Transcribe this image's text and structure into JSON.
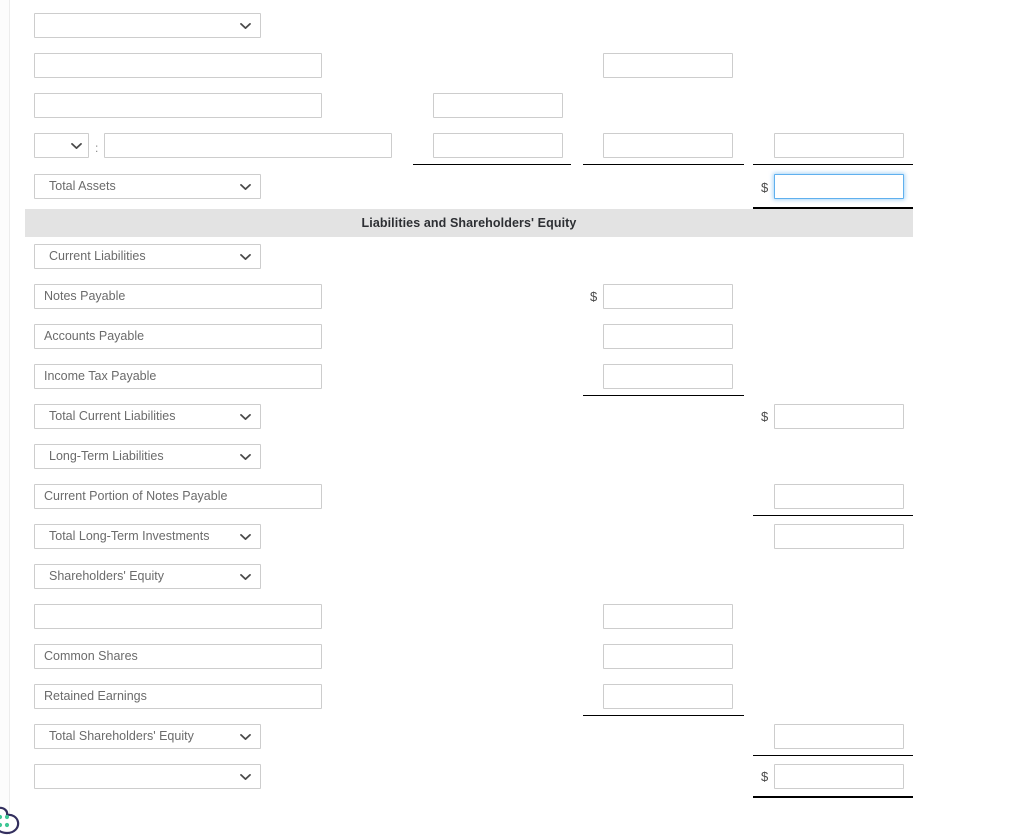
{
  "section_banner": {
    "label": "Liabilities and Shareholders' Equity"
  },
  "assets_section": {
    "rows": [
      {
        "type": "select",
        "value": "",
        "col3": "input"
      },
      {
        "type": "text",
        "value": "",
        "col3": "input"
      },
      {
        "type": "text",
        "value": "",
        "col2": "input"
      },
      {
        "type": "select_colon_text",
        "select_value": "",
        "separator": ":",
        "text_value": ""
      },
      {
        "type": "select",
        "value": "Total Assets",
        "total": true
      }
    ],
    "total_assets_label": "Total Assets",
    "total_assets_currency": "$",
    "total_assets_value": ""
  },
  "liabilities_section": {
    "rows": [
      {
        "kind": "select",
        "label": "Current Liabilities"
      },
      {
        "kind": "text",
        "label": "Notes Payable",
        "currency": "$",
        "amount": ""
      },
      {
        "kind": "text",
        "label": "Accounts Payable",
        "amount": ""
      },
      {
        "kind": "text",
        "label": "Income Tax Payable",
        "amount": ""
      },
      {
        "kind": "select",
        "label": "Total Current Liabilities",
        "currency": "$",
        "amount": ""
      },
      {
        "kind": "select",
        "label": "Long-Term Liabilities"
      },
      {
        "kind": "text",
        "label": "Current Portion of Notes Payable",
        "amount": ""
      },
      {
        "kind": "select",
        "label": "Total Long-Term Investments",
        "amount": ""
      },
      {
        "kind": "select",
        "label": "Shareholders' Equity"
      },
      {
        "kind": "text",
        "label": "",
        "amount": ""
      },
      {
        "kind": "text",
        "label": "Common Shares",
        "amount": ""
      },
      {
        "kind": "text",
        "label": "Retained Earnings",
        "amount": ""
      },
      {
        "kind": "select",
        "label": "Total Shareholders' Equity",
        "amount": ""
      },
      {
        "kind": "select",
        "label": "",
        "currency": "$",
        "amount": ""
      }
    ]
  },
  "currency_symbols": {
    "total_assets": "$",
    "notes_payable": "$",
    "total_current_liabilities": "$",
    "grand_total": "$"
  },
  "colors": {
    "banner_bg": "#e3e3e3",
    "field_border": "#cdcdcd",
    "focus_border": "#60b0ee",
    "text": "#6b6b6b",
    "rule": "#000000"
  },
  "cursor_icon": "cursor-paw-icon"
}
